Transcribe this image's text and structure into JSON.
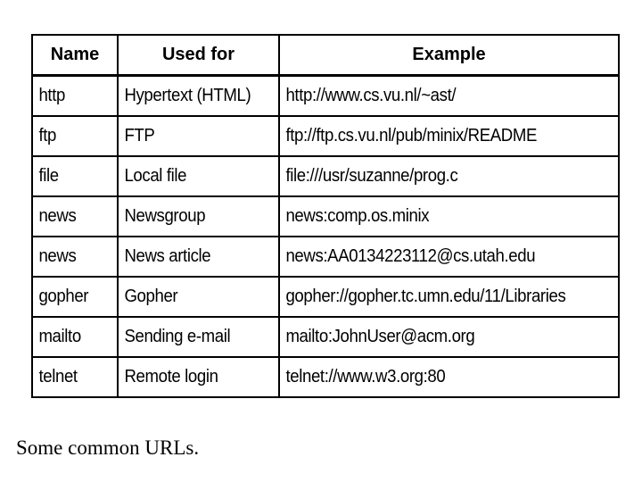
{
  "figure": {
    "caption": "Some common URLs."
  },
  "table": {
    "headers": {
      "name": "Name",
      "used_for": "Used for",
      "example": "Example"
    },
    "rows": [
      {
        "name": "http",
        "used_for": "Hypertext (HTML)",
        "example": "http://www.cs.vu.nl/~ast/"
      },
      {
        "name": "ftp",
        "used_for": "FTP",
        "example": "ftp://ftp.cs.vu.nl/pub/minix/README"
      },
      {
        "name": "file",
        "used_for": "Local file",
        "example": "file:///usr/suzanne/prog.c"
      },
      {
        "name": "news",
        "used_for": "Newsgroup",
        "example": "news:comp.os.minix"
      },
      {
        "name": "news",
        "used_for": "News article",
        "example": "news:AA0134223112@cs.utah.edu"
      },
      {
        "name": "gopher",
        "used_for": "Gopher",
        "example": "gopher://gopher.tc.umn.edu/11/Libraries"
      },
      {
        "name": "mailto",
        "used_for": "Sending e-mail",
        "example": "mailto:JohnUser@acm.org"
      },
      {
        "name": "telnet",
        "used_for": "Remote login",
        "example": "telnet://www.w3.org:80"
      }
    ]
  },
  "colors": {
    "background": "#ffffff",
    "text": "#000000",
    "border": "#000000"
  }
}
